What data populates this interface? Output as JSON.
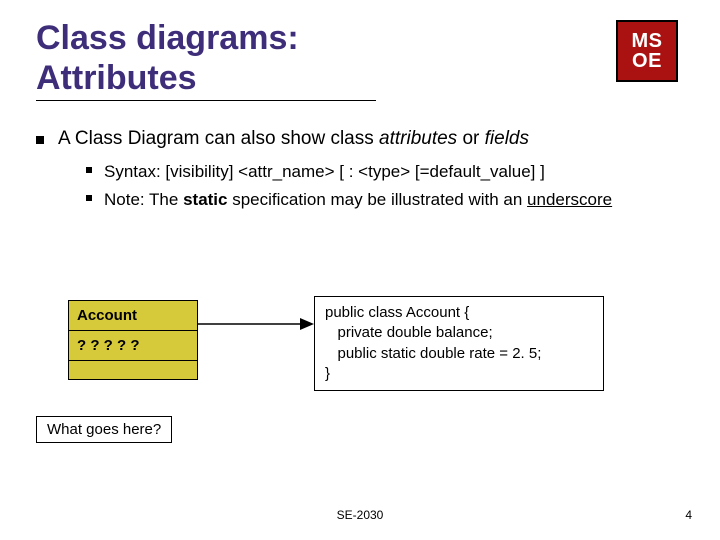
{
  "title_line1": "Class diagrams:",
  "title_line2": "Attributes",
  "logo": {
    "row1": "MS",
    "row2": "OE"
  },
  "main_point_pre": "A Class Diagram can also show class ",
  "main_point_attr": "attributes ",
  "main_point_or": "or ",
  "main_point_fields": "fields",
  "sub1": "Syntax: [visibility] <attr_name> [ : <type> [=default_value] ]",
  "sub2_pre": "Note: The ",
  "sub2_static": "static",
  "sub2_mid": " specification may be illustrated with an ",
  "sub2_under": "underscore",
  "uml": {
    "name": "Account",
    "attrs": " ? ? ? ? ?"
  },
  "code": {
    "l1": "public class Account {",
    "l2": "   private double balance;",
    "l3": "   public static double rate = 2. 5;",
    "l4": "}"
  },
  "what": "What goes here?",
  "footer_center": "SE-2030",
  "footer_right": "4"
}
